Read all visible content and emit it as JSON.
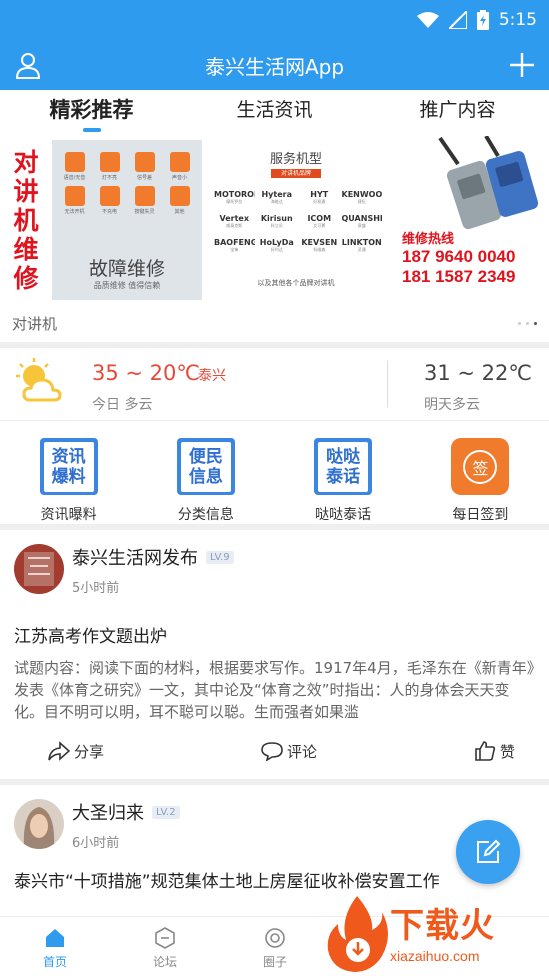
{
  "status_bar": {
    "time": "5:15"
  },
  "app_bar": {
    "title": "泰兴生活网App"
  },
  "tabs": [
    {
      "label": "精彩推荐",
      "active": true
    },
    {
      "label": "生活资讯",
      "active": false
    },
    {
      "label": "推广内容",
      "active": false
    }
  ],
  "banner": {
    "left_title": [
      "对",
      "讲",
      "机",
      "维",
      "修"
    ],
    "fault_tiles": [
      "语音/无音",
      "灯不亮",
      "信号差",
      "声音小",
      "无法开机",
      "不充电",
      "按键失灵",
      "其他"
    ],
    "fault_title": "故障维修",
    "fault_sub": "品质维修  值得信赖",
    "service_title": "服务机型",
    "service_tag": "对讲机品牌",
    "brands": [
      {
        "name": "MOTOROLA",
        "sub": "摩托罗拉"
      },
      {
        "name": "Hytera",
        "sub": "海能达"
      },
      {
        "name": "HYT",
        "sub": "好易通"
      },
      {
        "name": "KENWOOD",
        "sub": "建伍"
      },
      {
        "name": "Vertex",
        "sub": "威泰克斯"
      },
      {
        "name": "Kirisun",
        "sub": "科立讯"
      },
      {
        "name": "ICOM",
        "sub": "艾可慕"
      },
      {
        "name": "QUANSHENG",
        "sub": "泉盛"
      },
      {
        "name": "BAOFENG",
        "sub": "宝锋"
      },
      {
        "name": "HoLyDa",
        "sub": "好利达"
      },
      {
        "name": "KEVSEN",
        "sub": "科维森"
      },
      {
        "name": "LINKTON",
        "sub": "灵通"
      }
    ],
    "service_note": "以及其他各个品牌对讲机",
    "hotline_label": "维修热线",
    "phones": [
      "187 9640 0040",
      "181 1587 2349"
    ],
    "caption": "对讲机"
  },
  "weather": {
    "today_temp": "35 ~ 20℃",
    "city": "泰兴",
    "today_desc": "今日 多云",
    "tomorrow_temp": "31 ~ 22℃",
    "tomorrow_desc": "明天多云",
    "icon": "partly-cloudy-icon"
  },
  "quick_links": [
    {
      "label": "资讯曝料",
      "icon_text": [
        "资讯",
        "爆料"
      ]
    },
    {
      "label": "分类信息",
      "icon_text": [
        "便民",
        "信息"
      ]
    },
    {
      "label": "哒哒泰话",
      "icon_text": [
        "哒哒",
        "泰话"
      ]
    },
    {
      "label": "每日签到",
      "icon_text": [
        "签"
      ]
    }
  ],
  "posts": [
    {
      "author": "泰兴生活网发布",
      "level": "LV.9",
      "time": "5小时前",
      "title": "江苏高考作文题出炉",
      "body": "试题内容：阅读下面的材料，根据要求写作。1917年4月，毛泽东在《新青年》发表《体育之研究》一文，其中论及“体育之效”时指出：人的身体会天天变化。目不明可以明，耳不聪可以聪。生而强者如果滥",
      "share": "分享",
      "comment": "评论",
      "like": "赞"
    },
    {
      "author": "大圣归来",
      "level": "LV.2",
      "time": "6小时前",
      "title": "泰兴市“十项措施”规范集体土地上房屋征收补偿安置工作"
    }
  ],
  "bottom_nav": [
    {
      "label": "首页",
      "active": true
    },
    {
      "label": "论坛",
      "active": false
    },
    {
      "label": "圈子",
      "active": false
    }
  ],
  "watermark": {
    "text": "下载火",
    "url": "xiazaihuo.com"
  },
  "colors": {
    "primary": "#2e9bef",
    "accent_red": "#e0141e",
    "temp_red": "#e5493a",
    "orange": "#f07b2c"
  }
}
